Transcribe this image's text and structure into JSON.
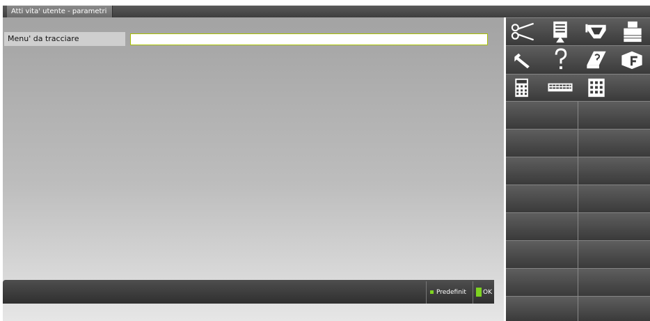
{
  "window": {
    "tab_title": "Atti vita' utente - parametri"
  },
  "form": {
    "field_label": "Menu' da tracciare",
    "field_value": "",
    "field_placeholder": ""
  },
  "bottom_bar": {
    "keys": [
      {
        "label": "Predefinit"
      },
      {
        "label": "OK"
      }
    ]
  },
  "toolbar": {
    "icons": [
      "scissors-icon",
      "document-paste-icon",
      "funnel-icon",
      "printer-icon",
      "wrench-icon",
      "help-icon",
      "book-help-icon",
      "box-f-icon",
      "calculator-icon",
      "keyboard-icon",
      "grid-icon"
    ],
    "empty_buttons": 15
  },
  "colors": {
    "accent_green": "#7ed321",
    "input_border": "#a8c000",
    "button_dark": "#3a3a3a"
  }
}
